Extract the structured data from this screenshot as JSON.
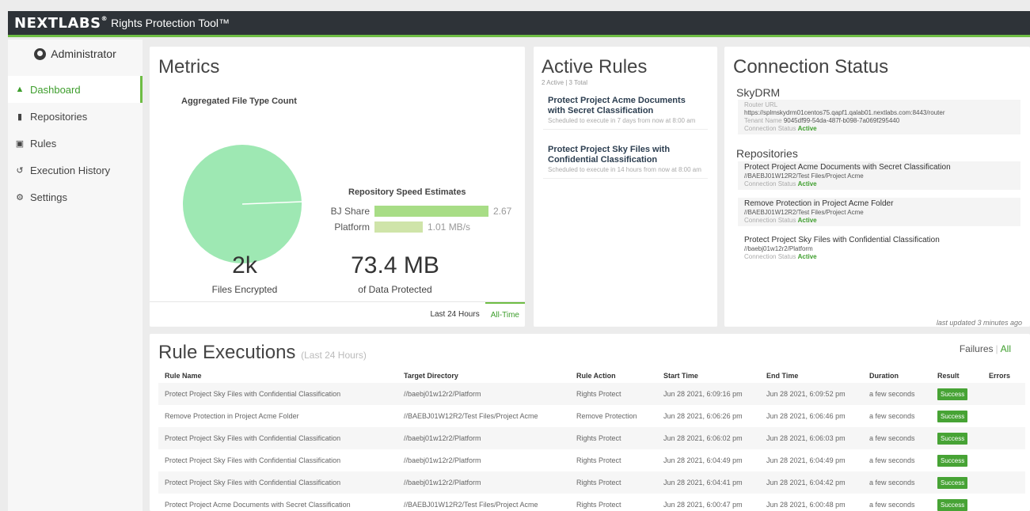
{
  "app": {
    "brand": "NEXTLABS",
    "subtitle": "Rights Protection Tool™"
  },
  "user": {
    "name": "Administrator"
  },
  "nav": [
    {
      "label": "Dashboard",
      "icon": "home-icon",
      "active": true
    },
    {
      "label": "Repositories",
      "icon": "folder-icon"
    },
    {
      "label": "Rules",
      "icon": "book-icon"
    },
    {
      "label": "Execution History",
      "icon": "history-icon"
    },
    {
      "label": "Settings",
      "icon": "gear-icon"
    }
  ],
  "metrics": {
    "title": "Metrics",
    "agg_title": "Aggregated File Type Count",
    "speed_title": "Repository Speed Estimates",
    "speeds": [
      {
        "label": "BJ Share",
        "value": 2.67,
        "display": "2.67"
      },
      {
        "label": "Platform",
        "value": 1.01,
        "display": "1.01 MB/s"
      }
    ],
    "files_count": "2k",
    "files_label": "Files Encrypted",
    "data_amount": "73.4 MB",
    "data_label": "of Data Protected",
    "tabs": [
      "Last 24 Hours",
      "All-Time"
    ],
    "active_tab": "All-Time"
  },
  "active_rules": {
    "title": "Active Rules",
    "count": "2 Active | 3 Total",
    "items": [
      {
        "name": "Protect Project Acme Documents with Secret Classification",
        "schedule": "Scheduled to execute in 7 days from now at 8:00 am"
      },
      {
        "name": "Protect Project Sky Files with Confidential Classification",
        "schedule": "Scheduled to execute in 14 hours from now at 8:00 am"
      }
    ]
  },
  "connection": {
    "title": "Connection Status",
    "skydrm": {
      "heading": "SkyDRM",
      "router_label": "Router URL",
      "router_url": "https://splmskydrm01centos75.qapf1.qalab01.nextlabs.com:8443/router",
      "tenant_label": "Tenant Name",
      "tenant": "9045df99-54da-487f-b098-7a069f295440",
      "status_label": "Connection Status",
      "status": "Active"
    },
    "repos_heading": "Repositories",
    "repos": [
      {
        "name": "Protect Project Acme Documents with Secret Classification",
        "dir": "//BAEBJ01W12R2/Test Files/Project Acme",
        "status_label": "Connection Status",
        "status": "Active"
      },
      {
        "name": "Remove Protection in Project Acme Folder",
        "dir": "//BAEBJ01W12R2/Test Files/Project Acme",
        "status_label": "Connection Status",
        "status": "Active"
      },
      {
        "name": "Protect Project Sky Files with Confidential Classification",
        "dir": "//baebj01w12r2/Platform",
        "status_label": "Connection Status",
        "status": "Active"
      }
    ],
    "updated": "last updated 3 minutes ago"
  },
  "executions": {
    "title": "Rule Executions",
    "subtitle": "(Last 24 Hours)",
    "filter_failures": "Failures",
    "filter_sep": "|",
    "filter_all": "All",
    "columns": [
      "Rule Name",
      "Target Directory",
      "Rule Action",
      "Start Time",
      "End Time",
      "Duration",
      "Result",
      "Errors"
    ],
    "rows": [
      [
        "Protect Project Sky Files with Confidential Classification",
        "//baebj01w12r2/Platform",
        "Rights Protect",
        "Jun 28 2021, 6:09:16 pm",
        "Jun 28 2021, 6:09:52 pm",
        "a few seconds",
        "Success",
        ""
      ],
      [
        "Remove Protection in Project Acme Folder",
        "//BAEBJ01W12R2/Test Files/Project Acme",
        "Remove Protection",
        "Jun 28 2021, 6:06:26 pm",
        "Jun 28 2021, 6:06:46 pm",
        "a few seconds",
        "Success",
        ""
      ],
      [
        "Protect Project Sky Files with Confidential Classification",
        "//baebj01w12r2/Platform",
        "Rights Protect",
        "Jun 28 2021, 6:06:02 pm",
        "Jun 28 2021, 6:06:03 pm",
        "a few seconds",
        "Success",
        ""
      ],
      [
        "Protect Project Sky Files with Confidential Classification",
        "//baebj01w12r2/Platform",
        "Rights Protect",
        "Jun 28 2021, 6:04:49 pm",
        "Jun 28 2021, 6:04:49 pm",
        "a few seconds",
        "Success",
        ""
      ],
      [
        "Protect Project Sky Files with Confidential Classification",
        "//baebj01w12r2/Platform",
        "Rights Protect",
        "Jun 28 2021, 6:04:41 pm",
        "Jun 28 2021, 6:04:42 pm",
        "a few seconds",
        "Success",
        ""
      ],
      [
        "Protect Project Acme Documents with Secret Classification",
        "//BAEBJ01W12R2/Test Files/Project Acme",
        "Rights Protect",
        "Jun 28 2021, 6:00:47 pm",
        "Jun 28 2021, 6:00:48 pm",
        "a few seconds",
        "Success",
        ""
      ]
    ]
  },
  "colors": {
    "accent": "#6ebd44",
    "active_text": "#3e9e2d",
    "topbar": "#2e3338",
    "pie": "#9ee8b3",
    "bar_bj": "#a8dd86",
    "bar_platform": "#cfe4a9"
  }
}
